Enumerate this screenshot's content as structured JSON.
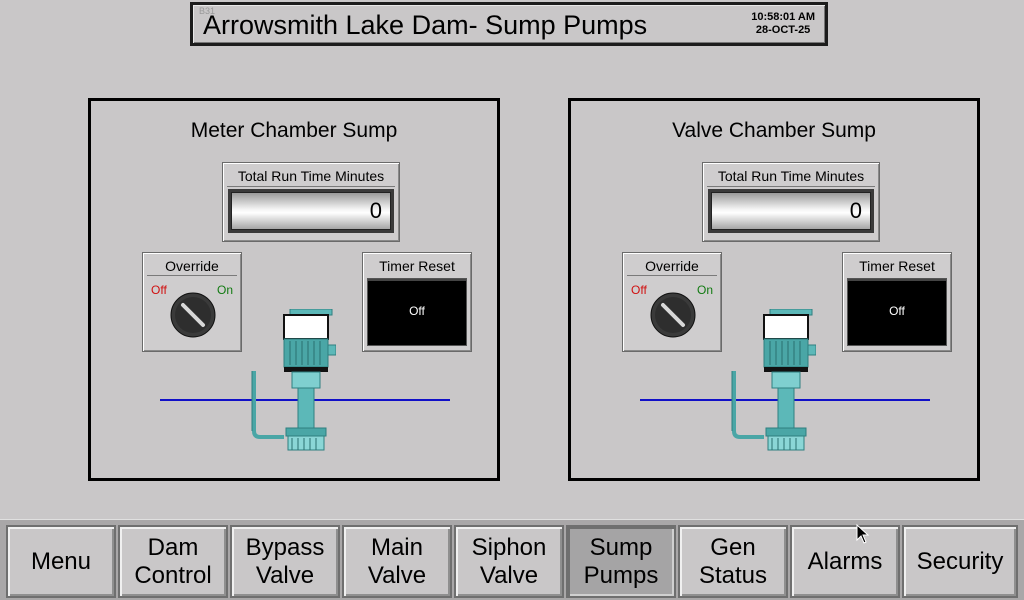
{
  "header": {
    "screen_id": "B31",
    "title": "Arrowsmith Lake Dam- Sump Pumps",
    "time": "10:58:01 AM",
    "date": "28-OCT-25"
  },
  "panels": [
    {
      "title": "Meter Chamber Sump",
      "runtime_label": "Total Run Time Minutes",
      "runtime_value": "0",
      "override_label": "Override",
      "override_off": "Off",
      "override_on": "On",
      "override_state": "off",
      "timer_label": "Timer Reset",
      "timer_value": "Off"
    },
    {
      "title": "Valve Chamber Sump",
      "runtime_label": "Total Run Time Minutes",
      "runtime_value": "0",
      "override_label": "Override",
      "override_off": "Off",
      "override_on": "On",
      "override_state": "off",
      "timer_label": "Timer Reset",
      "timer_value": "Off"
    }
  ],
  "nav": {
    "active": "Sump Pumps",
    "items": [
      "Menu",
      "Dam\nControl",
      "Bypass\nValve",
      "Main\nValve",
      "Siphon\nValve",
      "Sump\nPumps",
      "Gen\nStatus",
      "Alarms",
      "Security"
    ]
  },
  "colors": {
    "background": "#c9c7c8",
    "water": "#1010c8",
    "off_red": "#d01010",
    "on_green": "#117a11",
    "pump_teal": "#5cb8b8"
  },
  "icons": [
    "rotary-switch-icon",
    "sump-pump-icon",
    "mouse-pointer-icon"
  ]
}
